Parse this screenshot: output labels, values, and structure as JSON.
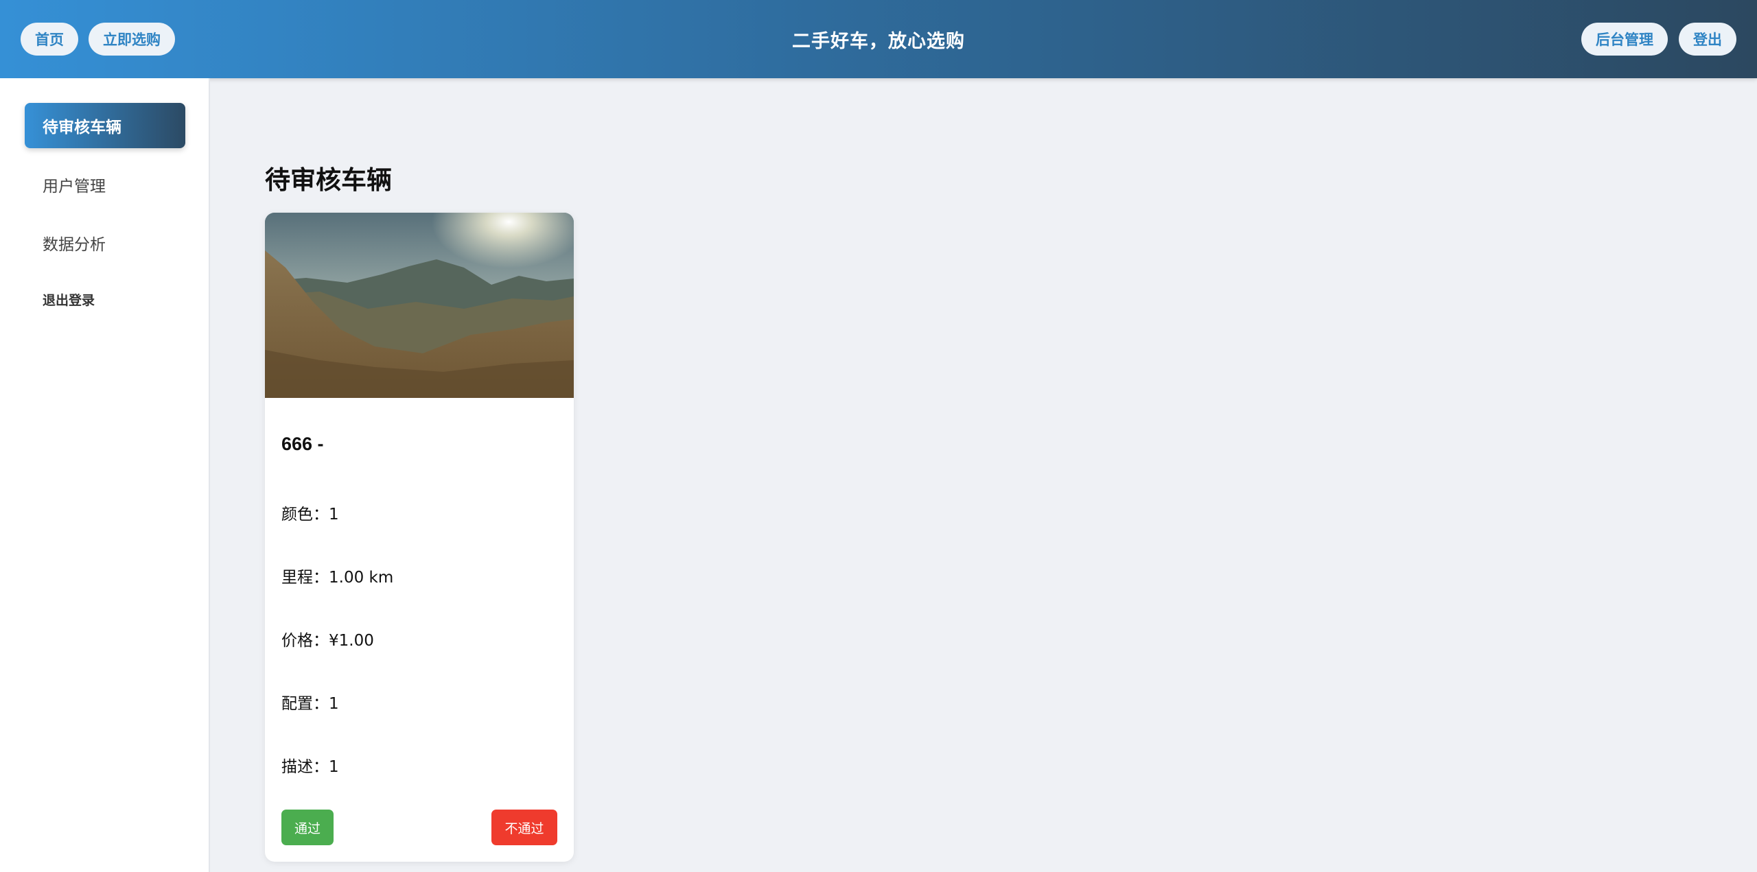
{
  "header": {
    "home_label": "首页",
    "buy_label": "立即选购",
    "title": "二手好车，放心选购",
    "admin_label": "后台管理",
    "logout_label": "登出"
  },
  "sidebar": {
    "items": [
      {
        "label": "待审核车辆",
        "active": true
      },
      {
        "label": "用户管理",
        "active": false
      },
      {
        "label": "数据分析",
        "active": false
      },
      {
        "label": "退出登录",
        "active": false
      }
    ]
  },
  "main": {
    "title": "待审核车辆",
    "cards": [
      {
        "title": "666 -",
        "color": "颜色：1",
        "mileage": "里程：1.00 km",
        "price": "价格：¥1.00",
        "config": "配置：1",
        "description": "描述：1",
        "approve_label": "通过",
        "reject_label": "不通过"
      }
    ]
  },
  "colors": {
    "header_start": "#3590d6",
    "header_end": "#2c4860",
    "approve": "#4bad4f",
    "reject": "#ef3b2d",
    "background": "#eff1f5"
  }
}
